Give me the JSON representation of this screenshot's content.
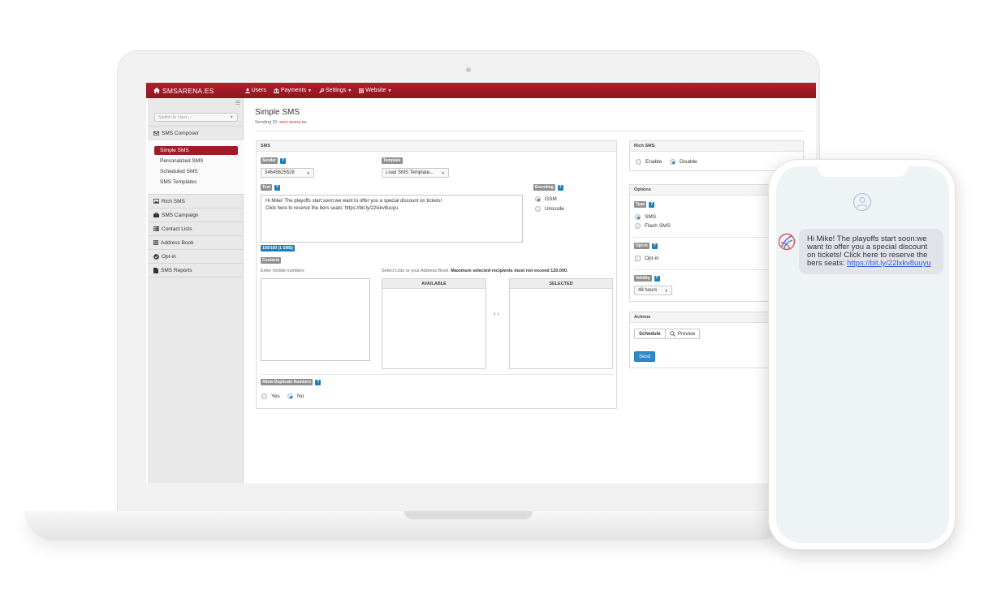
{
  "navbar": {
    "brand": "SMSARENA.ES",
    "items": [
      {
        "label": "Users",
        "icon": "user-icon",
        "dropdown": false
      },
      {
        "label": "Payments",
        "icon": "bank-icon",
        "dropdown": true
      },
      {
        "label": "Settings",
        "icon": "wrench-icon",
        "dropdown": true
      },
      {
        "label": "Website",
        "icon": "grid-icon",
        "dropdown": true
      }
    ]
  },
  "sidebar": {
    "switch_user_placeholder": "Switch to User ...",
    "composer_label": "SMS Composer",
    "composer_items": [
      "Simple SMS",
      "Personalized SMS",
      "Scheduled SMS",
      "SMS Templates"
    ],
    "active_item": "Simple SMS",
    "sections": [
      "Rich SMS",
      "SMS Campaign",
      "Contact Lists",
      "Address Book",
      "Opt-in",
      "SMS Reports"
    ]
  },
  "page": {
    "title": "Simple SMS",
    "sending_id_label": "Sending ID:",
    "sending_id_value": "sms-arena.es"
  },
  "sms_panel": {
    "heading": "SMS",
    "sender_label": "Sender",
    "sender_value": "34645625528",
    "template_label": "Template",
    "template_value": "Load SMS Template...",
    "text_label": "Text",
    "text_line1": "Hi Mike! The playoffs start soon:we want to offer you a special discount on tickets!",
    "text_line2": "Click here to reserve the bers seats: https://bit.ly/22lxkv8uuyu",
    "counter": "150/160 (1 SMS)",
    "encoding_label": "Encoding",
    "encoding_options": [
      "GSM",
      "Unicode"
    ],
    "encoding_selected": "GSM",
    "contacts_label": "Contacts",
    "mobile_hint": "Enter mobile numbers",
    "lists_hint": "Select Lists or your Address Book.",
    "lists_limit": "Maximum selected recipients must not exceed 120.000.",
    "available_header": "AVAILABLE",
    "selected_header": "SELECTED",
    "swap_symbol": "‹ ›",
    "duplicates_label": "Allow Duplicate Numbers",
    "duplicates_options": [
      "Yes",
      "No"
    ],
    "duplicates_selected": "No",
    "help_symbol": "?"
  },
  "rich_sms_panel": {
    "heading": "Rich SMS",
    "options": [
      "Enable",
      "Disable"
    ],
    "selected": "Disable"
  },
  "options_panel": {
    "heading": "Options",
    "type_label": "Type",
    "type_options": [
      "SMS",
      "Flash SMS"
    ],
    "type_selected": "SMS",
    "optin_label": "Opt-in",
    "optin_checkbox_label": "Opt-in",
    "validity_label": "Validity",
    "validity_value": "48 hours"
  },
  "actions_panel": {
    "heading": "Actions",
    "schedule_label": "Schedule",
    "preview_label": "Preview",
    "send_label": "Send"
  },
  "phone": {
    "message_text": "Hi Mike! The playoffs start soon:we want to offer you a special discount on tickets! Click here to reserve the bers seats:",
    "message_link": "https://bit.ly/22lxkv8uuyu"
  },
  "colors": {
    "navbar": "#9c1d27",
    "accent": "#1c7fb9",
    "send_button": "#2c86c7",
    "bubble": "#e2e2ea",
    "link": "#3b5fd6"
  }
}
